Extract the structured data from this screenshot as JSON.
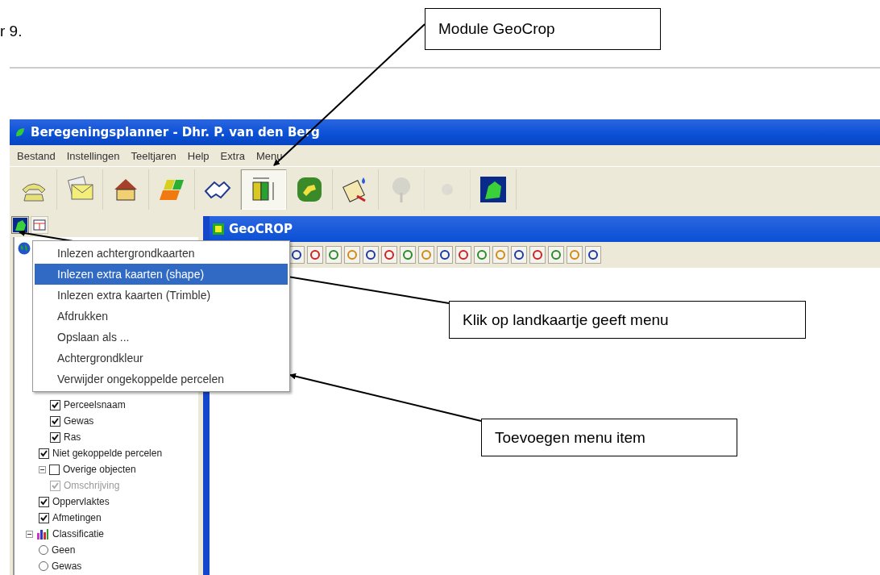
{
  "page_text": "r 9.",
  "window": {
    "title": "Beregeningsplanner - Dhr. P. van den Berg"
  },
  "menu_bar": [
    "Bestand",
    "Instellingen",
    "Teeltjaren",
    "Help",
    "Extra",
    "Menu"
  ],
  "toolbar": [
    {
      "pressed": false,
      "disabled": false
    },
    {
      "pressed": false,
      "disabled": false
    },
    {
      "pressed": false,
      "disabled": false
    },
    {
      "pressed": false,
      "disabled": false
    },
    {
      "pressed": false,
      "disabled": false
    },
    {
      "pressed": true,
      "disabled": false
    },
    {
      "pressed": false,
      "disabled": false
    },
    {
      "pressed": false,
      "disabled": false
    },
    {
      "pressed": false,
      "disabled": true
    },
    {
      "pressed": false,
      "disabled": true
    },
    {
      "pressed": false,
      "disabled": false
    }
  ],
  "panel_tabs": [
    {
      "selected": true
    },
    {
      "selected": false
    }
  ],
  "tree": {
    "children": [
      {
        "kind": "check",
        "label": "Perceelsnaam",
        "checked": true,
        "disabled": false
      },
      {
        "kind": "check",
        "label": "Gewas",
        "checked": true,
        "disabled": false
      },
      {
        "kind": "check",
        "label": "Ras",
        "checked": true,
        "disabled": false
      }
    ],
    "items": [
      {
        "kind": "check",
        "label": "Niet gekoppelde percelen",
        "checked": true,
        "disabled": false
      },
      {
        "kind": "check",
        "label": "Overige objecten",
        "checked": false,
        "disabled": false,
        "expanded": true,
        "children": [
          {
            "kind": "check",
            "label": "Omschrijving",
            "checked": true,
            "disabled": true
          }
        ]
      },
      {
        "kind": "check",
        "label": "Oppervlaktes",
        "checked": true,
        "disabled": false
      },
      {
        "kind": "check",
        "label": "Afmetingen",
        "checked": true,
        "disabled": false
      }
    ],
    "classification": {
      "label": "Classificatie",
      "expanded": true,
      "children": [
        {
          "kind": "radio",
          "label": "Geen",
          "selected": false
        },
        {
          "kind": "radio",
          "label": "Gewas",
          "selected": false
        }
      ]
    }
  },
  "context_menu": [
    {
      "label": "Inlezen achtergrondkaarten",
      "selected": false
    },
    {
      "label": "Inlezen extra kaarten (shape)",
      "selected": true
    },
    {
      "label": "Inlezen extra kaarten (Trimble)",
      "selected": false
    },
    {
      "label": "Afdrukken",
      "selected": false
    },
    {
      "label": "Opslaan als ...",
      "selected": false
    },
    {
      "label": "Achtergrondkleur",
      "selected": false
    },
    {
      "label": "Verwijder ongekoppelde percelen",
      "selected": false
    }
  ],
  "child_window": {
    "title": "GeoCROP"
  },
  "callouts": [
    {
      "text": "Module GeoCrop"
    },
    {
      "text": "Klik op landkaartje geeft menu"
    },
    {
      "text": "Toevoegen menu item"
    }
  ]
}
